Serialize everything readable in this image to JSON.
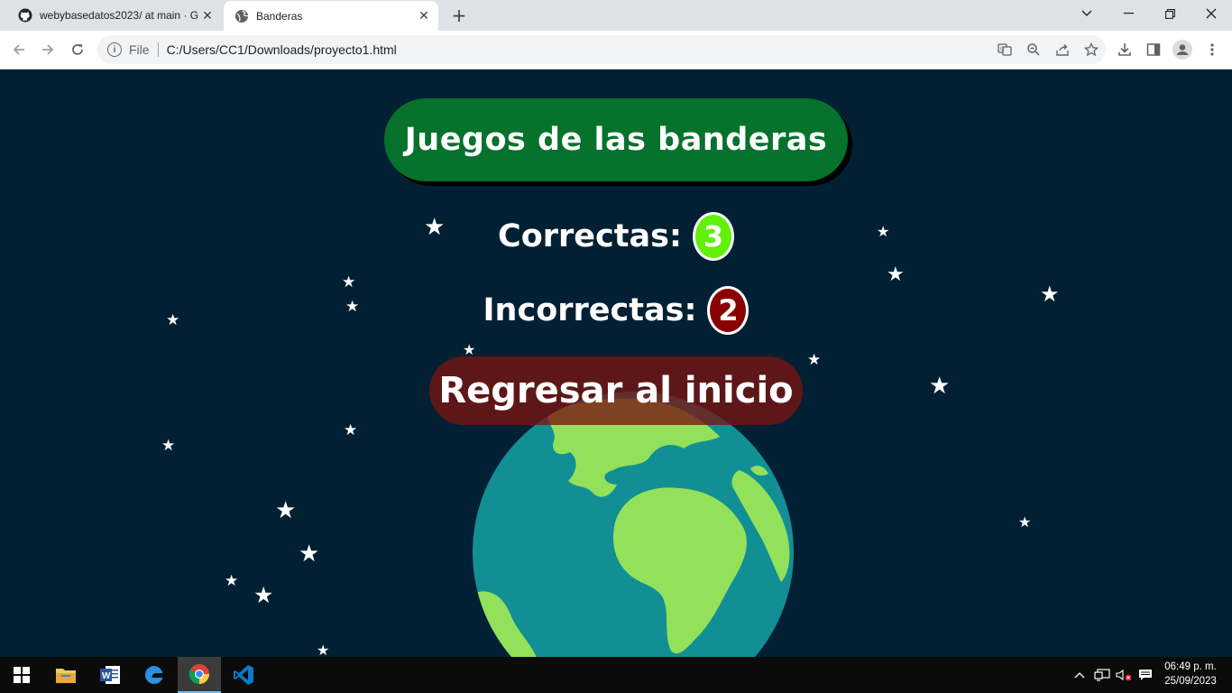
{
  "browser": {
    "tabs": [
      {
        "title": "webybasedatos2023/ at main · G",
        "favicon": "github-icon",
        "active": false
      },
      {
        "title": "Banderas",
        "favicon": "globe-icon",
        "active": true
      }
    ],
    "url_scheme_label": "File",
    "url": "C:/Users/CC1/Downloads/proyecto1.html"
  },
  "page": {
    "title": "Juegos de las banderas",
    "correct_label": "Correctas:",
    "correct_count": "3",
    "incorrect_label": "Incorrectas:",
    "incorrect_count": "2",
    "back_button": "Regresar al inicio"
  },
  "colors": {
    "page_background": "#012033",
    "title_pill": "#06722c",
    "correct_badge": "#61f10a",
    "incorrect_badge": "#8a0000",
    "back_button": "#781412",
    "earth_ocean": "#128f95",
    "earth_land": "#93e05a"
  },
  "taskbar": {
    "apps": [
      "windows-start-icon",
      "file-explorer-icon",
      "word-icon",
      "edge-icon",
      "chrome-icon",
      "vscode-icon"
    ],
    "active_app": "chrome-icon",
    "clock_time": "06:49 p. m.",
    "clock_date": "25/09/2023"
  }
}
